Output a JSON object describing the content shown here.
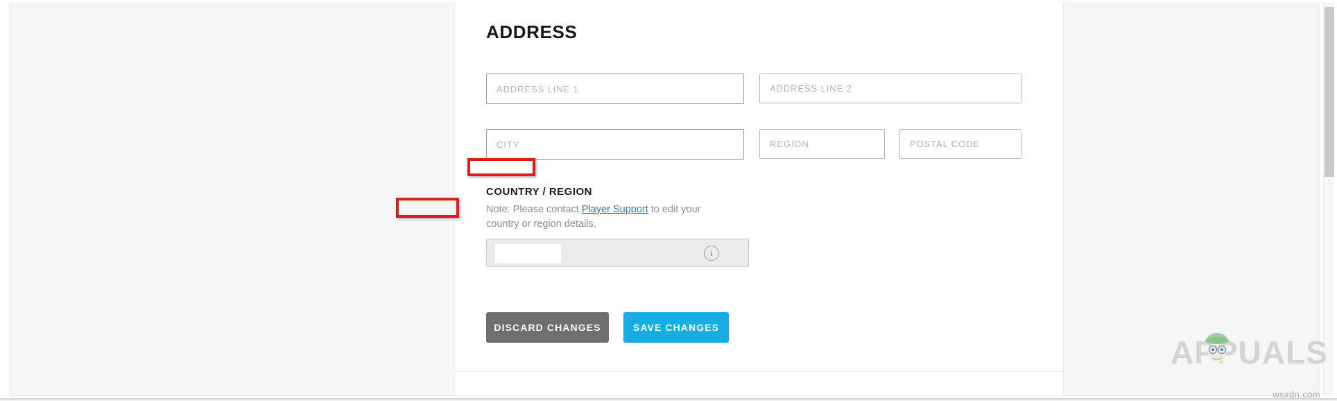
{
  "section": {
    "title": "ADDRESS"
  },
  "form": {
    "address_line_1": {
      "placeholder": "ADDRESS LINE 1",
      "value": ""
    },
    "address_line_2": {
      "placeholder": "ADDRESS LINE 2",
      "value": ""
    },
    "city": {
      "placeholder": "CITY",
      "value": ""
    },
    "region": {
      "placeholder": "REGION",
      "value": ""
    },
    "postal_code": {
      "placeholder": "POSTAL CODE",
      "value": ""
    }
  },
  "country_region": {
    "label": "COUNTRY / REGION",
    "note_prefix": "Note: Please contact ",
    "note_link": "Player Support",
    "note_suffix": " to edit your country or region details.",
    "selected_value": "",
    "info_icon": "info-icon",
    "disabled": true
  },
  "buttons": {
    "discard": "DISCARD CHANGES",
    "save": "SAVE CHANGES"
  },
  "colors": {
    "save_button": "#16ade4",
    "discard_button": "#6e6e6e",
    "link": "#3a78a8",
    "annotation": "#e01b1b",
    "page_background": "#f6f6f6",
    "card_background": "#ffffff",
    "disabled_field": "#ececec"
  },
  "watermark": {
    "brand": "APPUALS",
    "site": "wsxdn.com"
  },
  "scrollbar": {
    "orientation": "vertical"
  }
}
